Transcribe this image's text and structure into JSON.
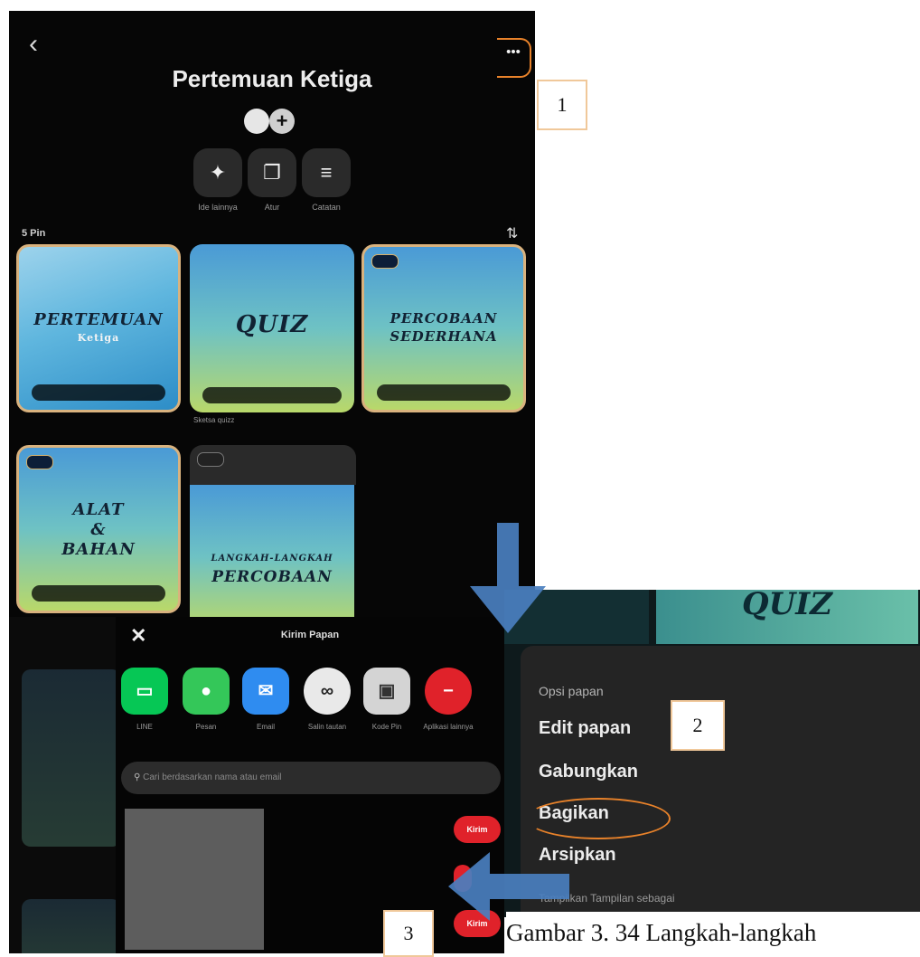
{
  "board": {
    "title": "Pertemuan Ketiga",
    "add_collaborator_icon": "+",
    "actions": [
      {
        "icon": "sparkle-icon",
        "label": "Ide lainnya"
      },
      {
        "icon": "organize-icon",
        "label": "Atur"
      },
      {
        "icon": "notes-icon",
        "label": "Catatan"
      }
    ],
    "pin_count": "5 Pin",
    "pins": [
      {
        "title": "PERTEMUAN",
        "subtitle": "Ketiga"
      },
      {
        "title": "QUIZ",
        "caption": "Sketsa quizz"
      },
      {
        "title_line1": "PERCOBAAN",
        "title_line2": "SEDERHANA"
      },
      {
        "title_line1": "ALAT",
        "title_line2": "&",
        "title_line3": "BAHAN"
      },
      {
        "title_line1": "LANGKAH-LANGKAH",
        "title_line2": "PERCOBAAN"
      }
    ]
  },
  "share": {
    "title": "Kirim Papan",
    "close_icon": "✕",
    "apps": [
      {
        "label": "LINE",
        "icon": "line-icon",
        "color": "#06c755"
      },
      {
        "label": "Pesan",
        "icon": "messages-icon",
        "color": "#34c759"
      },
      {
        "label": "Email",
        "icon": "mail-icon",
        "color": "#2f8cf0"
      },
      {
        "label": "Salin tautan",
        "icon": "link-icon",
        "color": "#e9e9e9"
      },
      {
        "label": "Kode Pin",
        "icon": "pincode-icon",
        "color": "#d4d4d4"
      },
      {
        "label": "Aplikasi lainnya",
        "icon": "more-apps-icon",
        "color": "#e0222a"
      }
    ],
    "search_placeholder": "Cari berdasarkan nama atau email",
    "send_label": "Kirim"
  },
  "options": {
    "heading": "Opsi papan",
    "items": [
      "Edit papan",
      "Gabungkan",
      "Bagikan",
      "Arsipkan"
    ],
    "footer": "Tampilkan Tampilan sebagai",
    "bg_text": "QUIZ"
  },
  "callouts": {
    "one": "1",
    "two": "2",
    "three": "3"
  },
  "caption": "Gambar 3. 34 Langkah-langkah",
  "colors": {
    "highlight": "#e8822a",
    "arrow": "#4a7fbf",
    "callout_border": "#f0c89a"
  }
}
